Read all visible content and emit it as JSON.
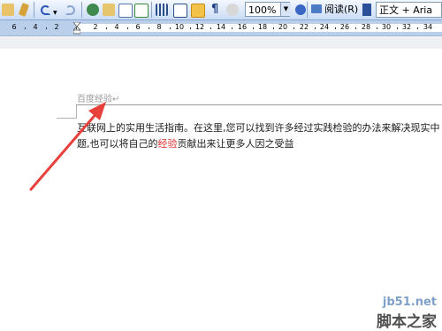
{
  "toolbar": {
    "zoom_value": "100%",
    "read_label": "阅读(R)",
    "style_value": "正文 + Aria",
    "colors": {
      "bar_top": "#f4f8ff",
      "bar_bottom": "#c9dcf5"
    }
  },
  "ruler": {
    "labels": [
      "6",
      "4",
      "2",
      "2",
      "4",
      "6",
      "8",
      "10",
      "12",
      "14",
      "16",
      "18",
      "20",
      "22",
      "24",
      "26",
      "28",
      "30",
      "32",
      "34"
    ]
  },
  "document": {
    "header_text": "百度经验↵",
    "body_line1": "互联网上的实用生活指南。在这里,您可以找到许多经过实践检验的办法来解决现实中",
    "body_line2_before": "题,也可以将自己的",
    "body_line2_highlight": "经验",
    "body_line2_after": "贡献出来让更多人因之受益"
  },
  "watermark": {
    "url": "jb51.net",
    "name": "脚本之家"
  }
}
